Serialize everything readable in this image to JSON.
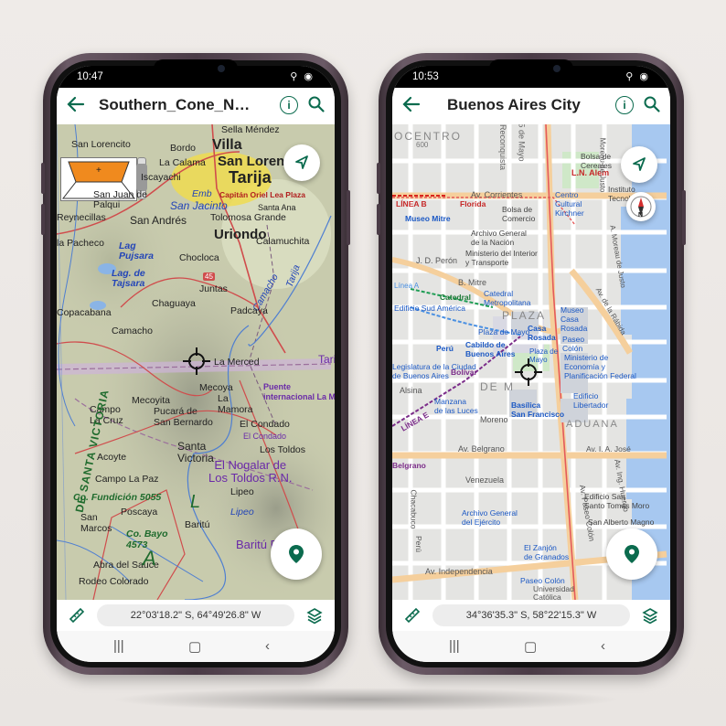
{
  "left_phone": {
    "status": {
      "time": "10:47",
      "icons": "⚲ ◉"
    },
    "appbar": {
      "title": "Southern_Cone_N…"
    },
    "coordinates": "22°03'18.2\" S, 64°49'26.8\" W",
    "map_labels": {
      "sella_mendez": "Sella Méndez",
      "san_lorencito": "San Lorencito",
      "bordo": "Bordo",
      "villa": "Villa",
      "la_calama": "La Calama",
      "san_lorenzo": "San Loren",
      "iscayachi": "Iscayachi",
      "tarija": "Tarija",
      "emb": "Emb",
      "san_jacinto": "San Jacinto",
      "capitan_oriel": "Capitán Oriel Lea Plaza",
      "santa_ana": "Santa Ana",
      "san_juan_de_palqui": "San Juan de\nPalqui",
      "reynecillas": "Reynecillas",
      "san_andres": "San Andrés",
      "tolomosa": "Tolomosa Grande",
      "uriondo": "Uriondo",
      "calamuchita": "Calamuchita",
      "la_pacheco": "la Pacheco",
      "lag_pujsara": "Lag\nPujsara",
      "chocloca": "Chocloca",
      "lag_tajsara": "Lag. de\nTajsara",
      "juntas": "Juntas",
      "camacho_river": "Camacho",
      "chaguaya": "Chaguaya",
      "tarija_river": "Tarija",
      "copacabana": "Copacabana",
      "padcaya": "Padcaya",
      "camacho": "Camacho",
      "la_merced": "La Merced",
      "tariq": "Tari",
      "mecoya": "Mecoya",
      "mecoyita": "Mecoyita",
      "la_mamora": "La\nMamora",
      "puente_internacional": "Puente\ninternacional La M",
      "campo_la_cruz": "Campo\nLa Cruz",
      "pucara": "Pucará de\nSan Bernardo",
      "el_condado": "El Condado",
      "el_condado2": "El Condado",
      "santa_victoria": "Santa\nVictoria",
      "los_toldos": "Los Toldos",
      "acoyte": "Acoyte",
      "nogalar": "El Nogalar de\nLos Toldos R.N.",
      "campo_la_paz": "Campo La Paz",
      "co_fundicion": "Co. Fundición 5055",
      "lipeo": "Lipeo",
      "poscaya": "Poscaya",
      "lipeo_river": "Lipeo",
      "san_marcos": "San\nMarcos",
      "baritu": "Baritú",
      "co_bayo": "Co. Bayo\n4573",
      "baritu_pn": "Baritú P",
      "abra_del_sauce": "Abra del Sauce",
      "rodeo_colorado": "Rodeo Colorado",
      "sierra_santa_victoria": "DE SANTA VICTORIA",
      "big_a": "A",
      "big_l": "L",
      "ruta_45": "45"
    }
  },
  "right_phone": {
    "status": {
      "time": "10:53",
      "icons": "⚲ ◉"
    },
    "appbar": {
      "title": "Buenos Aires City"
    },
    "coordinates": "34°36'35.3\" S, 58°22'15.3\" W",
    "map_labels": {
      "ocentro": "OCENTRO",
      "reconquista": "Reconquista",
      "mayo_25": "25 de Mayo",
      "bolsa": "Bolsa de\nCereales",
      "ln_alem": "L.N. Alem",
      "corrientes": "Av. Corrientes",
      "florida": "Florida",
      "linea_b": "LÍNEA B",
      "bolsa_comercio": "Bolsa de\nComercio",
      "centro_cultural": "Centro\nCultural\nKirchner",
      "instituto": "Instituto\nTecnológico",
      "museo_mitre": "Museo Mitre",
      "archivo_nacion": "Archivo General\nde la Nación",
      "ministerio_interior": "Ministerio del Interior\ny Transporte",
      "peron": "J. D. Perón",
      "b_mitre": "B. Mitre",
      "catedral": "Catedral",
      "catedral_metro": "Catedral\nMetropolitana",
      "museo_casa_rosada": "Museo\nCasa\nRosada",
      "plaza_big": "PLAZA",
      "plaza_mayo": "Plaza de Mayo",
      "casa_rosada": "Casa\nRosada",
      "paseo_colon": "Paseo\nColón",
      "sud_america": "Edificio Sud América",
      "cabildo": "Cabildo de\nBuenos Aires",
      "peru": "Perú",
      "plaza_de_mayo2": "Plaza de\nMayo",
      "ministerio_economia": "Ministerio de\nEconomía y\nPlanificación Federal",
      "legislatura": "Legislatura de la Ciudad\nde Buenos Aires",
      "bolivar": "Bolívar",
      "alsina": "Alsina",
      "mayo_big": "DE M",
      "manzana": "Manzana\nde las Luces",
      "moreno": "Moreno",
      "basilica": "Basílica\nSan Francisco",
      "libertador": "Edificio\nLibertador",
      "aduana": "ADUANA",
      "linea_e": "LÍNEA E",
      "belgrano": "Av. Belgrano",
      "paseo_colon_av": "Av. Paseo Colón",
      "jose": "Av. I. A. José",
      "huergo": "Av. Ing. Huergo",
      "venezuela": "Venezuela",
      "belgrano_stn": "Belgrano",
      "ed_santo_tomas": "Edificio San\nSanto Tomás Moro",
      "san_alberto": "San Alberto Magno",
      "chacabuco": "Chacabuco",
      "archivo_ejercito": "Archivo General\ndel Ejército",
      "el_zanjon": "El Zanjón\nde Granados",
      "independencia": "Av. Independencia",
      "paseo_colon_stn": "Paseo Colón",
      "univ_catolica": "Universidad\nCatólica",
      "moreau": "Moreau de Justo",
      "a_moreau": "A. Moreau de Justo",
      "av_rabida": "Av. de la Rábida",
      "lineaa": "Línea A",
      "peru2": "Perú",
      "lineab2": "600"
    }
  },
  "colors": {
    "accent": "#0b6b4e",
    "compass_red": "#d32f2f"
  }
}
